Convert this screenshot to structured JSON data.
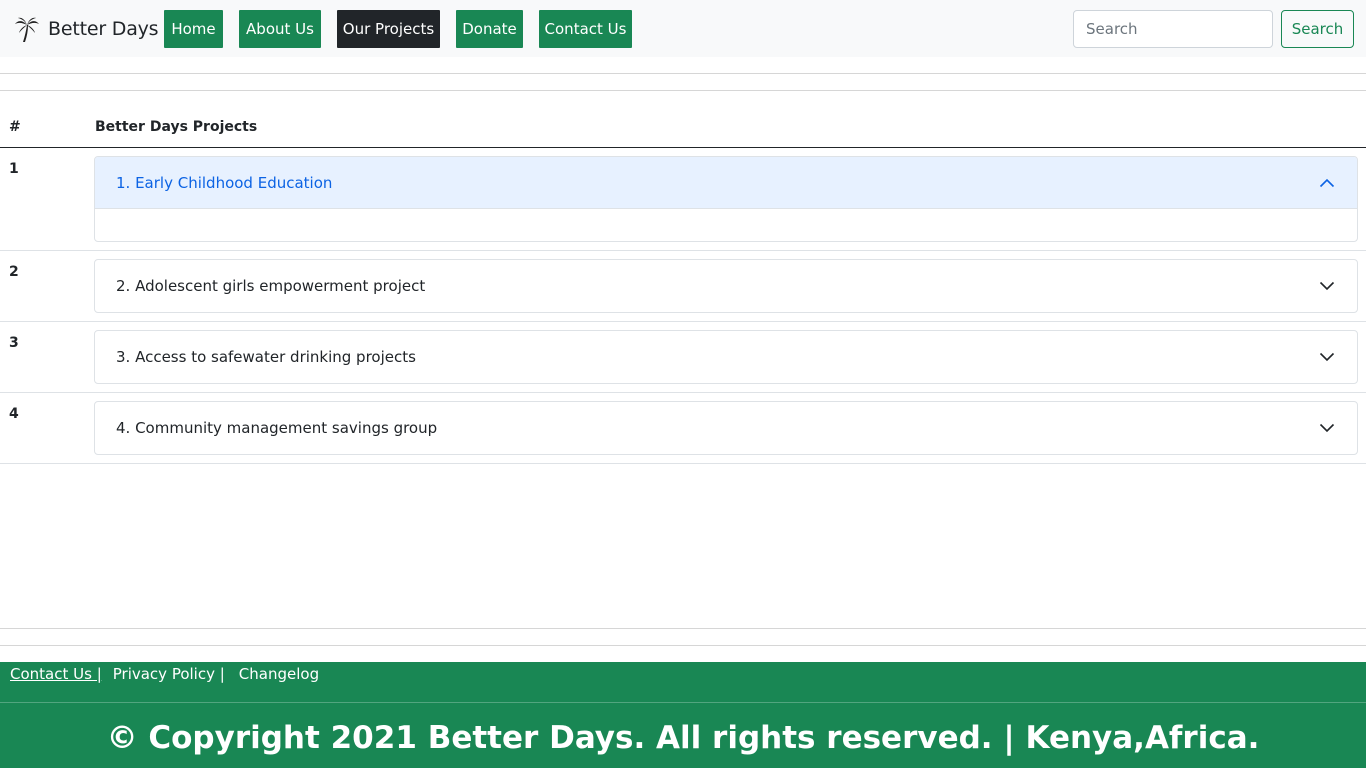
{
  "navbar": {
    "brand": "Better Days",
    "links": [
      {
        "label": "Home",
        "active": false
      },
      {
        "label": "About Us",
        "active": false
      },
      {
        "label": "Our Projects",
        "active": true
      },
      {
        "label": "Donate",
        "active": false
      },
      {
        "label": "Contact Us",
        "active": false
      }
    ],
    "search_placeholder": "Search",
    "search_button": "Search"
  },
  "table": {
    "headers": [
      "#",
      "Better Days Projects"
    ],
    "rows": [
      {
        "num": "1",
        "title": "1. Early Childhood Education",
        "expanded": true
      },
      {
        "num": "2",
        "title": "2. Adolescent girls empowerment project",
        "expanded": false
      },
      {
        "num": "3",
        "title": "3. Access to safewater drinking projects",
        "expanded": false
      },
      {
        "num": "4",
        "title": "4. Community management savings group",
        "expanded": false
      }
    ]
  },
  "footer": {
    "links": [
      "Contact Us |",
      "Privacy Policy |",
      "Changelog"
    ],
    "copyright": "© Copyright 2021 Better Days. All rights reserved. | Kenya,Africa."
  },
  "colors": {
    "brand_green": "#198754",
    "active_dark": "#212529",
    "accordion_open_bg": "#e7f1ff",
    "accordion_open_text": "#0c63e4"
  }
}
